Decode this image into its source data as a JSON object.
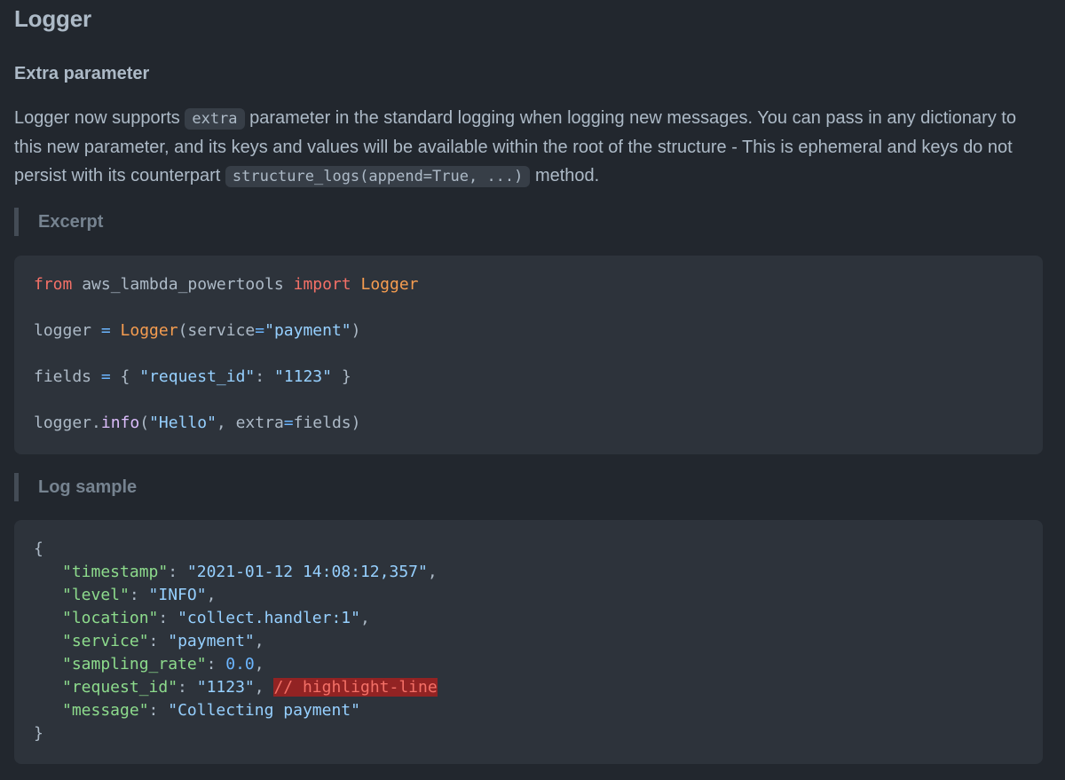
{
  "title": "Logger",
  "section": {
    "heading": "Extra parameter",
    "para": {
      "p1": "Logger now supports ",
      "code1": "extra",
      "p2": " parameter in the standard logging when logging new messages. You can pass in any dictionary to this new parameter, and its keys and values will be available within the root of the structure - This is ephemeral and keys do not persist with its counterpart ",
      "code2": "structure_logs(append=True, ...)",
      "p3": " method."
    }
  },
  "excerpt": {
    "label": "Excerpt",
    "line1": {
      "kw_from": "from",
      "module": " aws_lambda_powertools ",
      "kw_import": "import",
      "cls": " Logger"
    },
    "line2": {
      "var": "logger ",
      "eq": "=",
      "cls": " Logger",
      "open": "(service",
      "eq2": "=",
      "str": "\"payment\"",
      "close": ")"
    },
    "line3": {
      "var": "fields ",
      "eq": "=",
      "open": " { ",
      "key": "\"request_id\"",
      "colon": ": ",
      "val": "\"1123\"",
      "close": " }"
    },
    "line4": {
      "obj": "logger.",
      "fn": "info",
      "open": "(",
      "str": "\"Hello\"",
      "mid": ", extra",
      "eq": "=",
      "rest": "fields)"
    }
  },
  "log_sample": {
    "label": "Log sample",
    "open_brace": "{",
    "close_brace": "}",
    "rows": [
      {
        "key": "\"timestamp\"",
        "sep": ": ",
        "val": "\"2021-01-12 14:08:12,357\"",
        "tail": ","
      },
      {
        "key": "\"level\"",
        "sep": ": ",
        "val": "\"INFO\"",
        "tail": ","
      },
      {
        "key": "\"location\"",
        "sep": ": ",
        "val": "\"collect.handler:1\"",
        "tail": ","
      },
      {
        "key": "\"service\"",
        "sep": ": ",
        "val": "\"payment\"",
        "tail": ","
      },
      {
        "key": "\"sampling_rate\"",
        "sep": ": ",
        "num": "0.0",
        "tail": ","
      },
      {
        "key": "\"request_id\"",
        "sep": ": ",
        "val": "\"1123\"",
        "tail": ", ",
        "comment": "// highlight-line"
      },
      {
        "key": "\"message\"",
        "sep": ": ",
        "val": "\"Collecting payment\""
      }
    ]
  },
  "colors": {
    "background": "#22272e",
    "code_background": "#2d333b",
    "keyword": "#f47067",
    "class": "#f69d50",
    "string": "#96d0ff",
    "json_key": "#8ddb8c",
    "number": "#6cb6ff",
    "function": "#dcbdfb",
    "highlight": "#922323"
  }
}
